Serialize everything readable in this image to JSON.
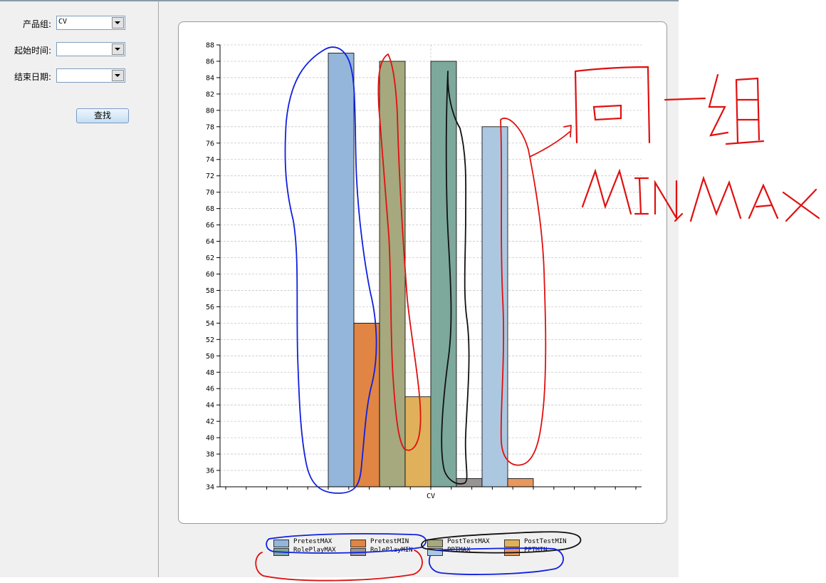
{
  "form": {
    "group_label": "产品组:",
    "group_value": "CV",
    "start_label": "起始时间:",
    "start_value": "",
    "end_label": "结束日期:",
    "end_value": "",
    "search_label": "查找"
  },
  "annotation": {
    "line1": "同一组",
    "line2": "MIN,MAX"
  },
  "chart_data": {
    "type": "bar",
    "categories": [
      "CV"
    ],
    "series": [
      {
        "name": "PretestMAX",
        "values": [
          87
        ],
        "color": "#94b6da"
      },
      {
        "name": "PretestMIN",
        "values": [
          54
        ],
        "color": "#e08543"
      },
      {
        "name": "PostTestMAX",
        "values": [
          86
        ],
        "color": "#a6a87e"
      },
      {
        "name": "PostTestMIN",
        "values": [
          45
        ],
        "color": "#e0b15a"
      },
      {
        "name": "RolePlayMAX",
        "values": [
          86
        ],
        "color": "#7da89c"
      },
      {
        "name": "RolePlayMIN",
        "values": [
          35
        ],
        "color": "#999494"
      },
      {
        "name": "PPTMAX",
        "values": [
          78
        ],
        "color": "#acc8e0"
      },
      {
        "name": "PPTMIN",
        "values": [
          35
        ],
        "color": "#e6985e"
      }
    ],
    "ylim": [
      34,
      88
    ],
    "yticks": [
      34,
      36,
      38,
      40,
      42,
      44,
      46,
      48,
      50,
      52,
      54,
      56,
      58,
      60,
      62,
      64,
      66,
      68,
      70,
      72,
      74,
      76,
      78,
      80,
      82,
      84,
      86,
      88
    ],
    "grid": true,
    "legend_position": "bottom",
    "title": "",
    "xlabel": "",
    "ylabel": ""
  }
}
